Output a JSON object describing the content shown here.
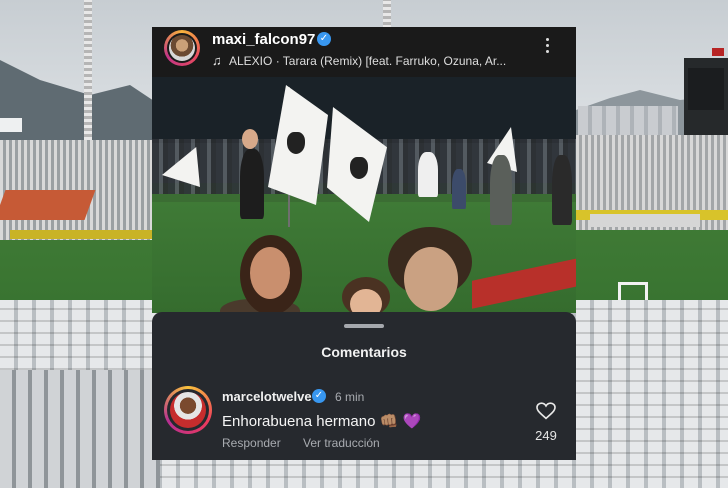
{
  "story": {
    "username": "maxi_falcon97",
    "verified_badge": "✓",
    "music_icon": "music-note-icon",
    "song": "ALEXIO · Tarara (Remix) [feat. Farruko, Ozuna, Ar..."
  },
  "comments": {
    "title": "Comentarios",
    "items": [
      {
        "username": "marcelotwelve",
        "verified_badge": "✓",
        "time": "6 min",
        "text": "Enhorabuena hermano 👊🏽 💜",
        "reply_label": "Responder",
        "translate_label": "Ver traducción",
        "likes": "249"
      }
    ]
  },
  "colors": {
    "sheet_background": "#26292e",
    "verified_blue": "#3897f0"
  }
}
